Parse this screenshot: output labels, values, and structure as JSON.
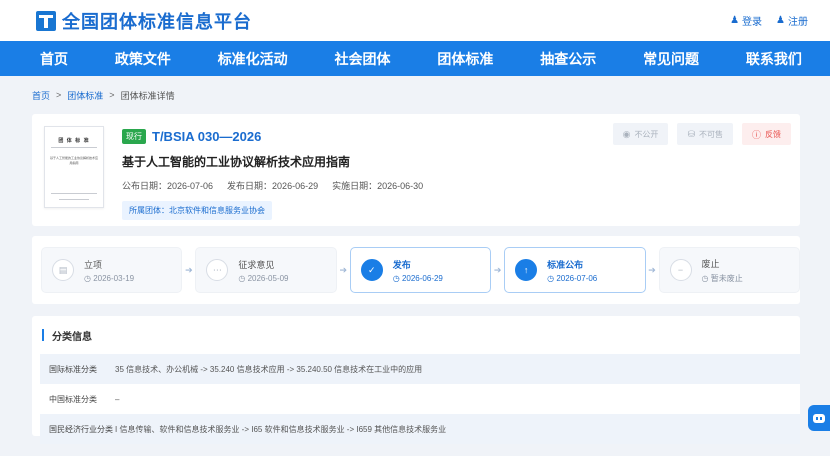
{
  "header": {
    "site_title": "全国团体标准信息平台",
    "login": "登录",
    "register": "注册"
  },
  "nav": [
    "首页",
    "政策文件",
    "标准化活动",
    "社会团体",
    "团体标准",
    "抽查公示",
    "常见问题",
    "联系我们"
  ],
  "breadcrumb": {
    "home": "首页",
    "standards": "团体标准",
    "current": "团体标准详情",
    "sep": ">"
  },
  "standard": {
    "status": "现行",
    "code": "T/BSIA 030—2026",
    "title": "基于人工智能的工业协议解析技术应用指南",
    "publish_date": "公布日期：2026-07-06",
    "release_date": "发布日期：2026-06-29",
    "implement_date": "实施日期：2026-06-30",
    "org": "所属团体：北京软件和信息服务业协会",
    "thumb_title": "团 体 标 准",
    "thumb_code": "T/BSIA 030—2026",
    "thumb_name": "基于人工智能的工业协议解析技术应用指南"
  },
  "actions": {
    "private": "不公开",
    "not_for_sale": "不可售",
    "feedback": "反馈"
  },
  "process": [
    {
      "name": "立项",
      "date": "2026-03-19",
      "active": false,
      "icon": "doc-icon"
    },
    {
      "name": "征求意见",
      "date": "2026-05-09",
      "active": false,
      "icon": "comment-icon"
    },
    {
      "name": "发布",
      "date": "2026-06-29",
      "active": true,
      "icon": "check-icon"
    },
    {
      "name": "标准公布",
      "date": "2026-07-06",
      "active": true,
      "icon": "upload-icon"
    },
    {
      "name": "废止",
      "date": "暂未废止",
      "active": false,
      "icon": "minus-icon"
    }
  ],
  "classification": {
    "title": "分类信息",
    "rows": [
      {
        "label": "国际标准分类",
        "value": "35 信息技术、办公机械 -> 35.240 信息技术应用 -> 35.240.50 信息技术在工业中的应用"
      },
      {
        "label": "中国标准分类",
        "value": "–"
      },
      {
        "label": "国民经济行业分类",
        "value": "I 信息传输、软件和信息技术服务业 -> I65 软件和信息技术服务业 -> I659 其他信息技术服务业"
      }
    ]
  },
  "colors": {
    "brand": "#1a7ee6",
    "status_green": "#2aa74d",
    "feedback_red": "#e9524f"
  }
}
